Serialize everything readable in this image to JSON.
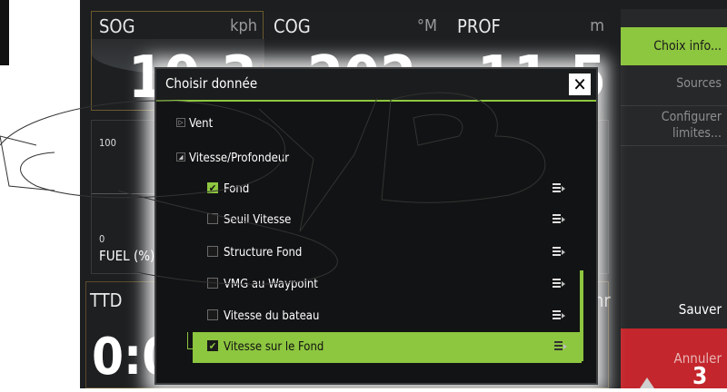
{
  "instruments": {
    "sog": {
      "label": "SOG",
      "unit": "kph",
      "value": "19.3"
    },
    "cog": {
      "label": "COG",
      "unit": "°M",
      "value": "202"
    },
    "prof": {
      "label": "PROF",
      "unit": "m",
      "value": "11.5"
    },
    "fuel": {
      "label": "FUEL (%)",
      "top": "100",
      "bottom": "0"
    },
    "right_gauge": {
      "top": "0",
      "bottom": "0",
      "unit": ")"
    },
    "ttd": {
      "label": "TTD",
      "value": "0:0"
    },
    "hr_unit": "hr",
    "bottom_right_value": "3"
  },
  "sidebar": {
    "choix_info": "Choix info...",
    "sources": "Sources",
    "configurer_line1": "Configurer",
    "configurer_line2": "limites...",
    "sauver": "Sauver",
    "annuler": "Annuler"
  },
  "dialog": {
    "title": "Choisir donnée",
    "close": "✕",
    "groups": [
      {
        "label": "Vent",
        "expanded": false
      },
      {
        "label": "Vitesse/Profondeur",
        "expanded": true
      }
    ],
    "items": [
      {
        "label": "Fond",
        "checked": true,
        "selected": false
      },
      {
        "label": "Seuil Vitesse",
        "checked": false,
        "selected": false
      },
      {
        "label": "Structure Fond",
        "checked": false,
        "selected": false
      },
      {
        "label": "VMG au Waypoint",
        "checked": false,
        "selected": false
      },
      {
        "label": "Vitesse du bateau",
        "checked": false,
        "selected": false
      },
      {
        "label": "Vitesse sur le Fond",
        "checked": true,
        "selected": true
      }
    ],
    "check_mark": "✔",
    "triangle_collapsed": "▷",
    "triangle_expanded": "◢"
  },
  "colors": {
    "accent": "#8dc63f",
    "cancel": "#c3262c"
  }
}
